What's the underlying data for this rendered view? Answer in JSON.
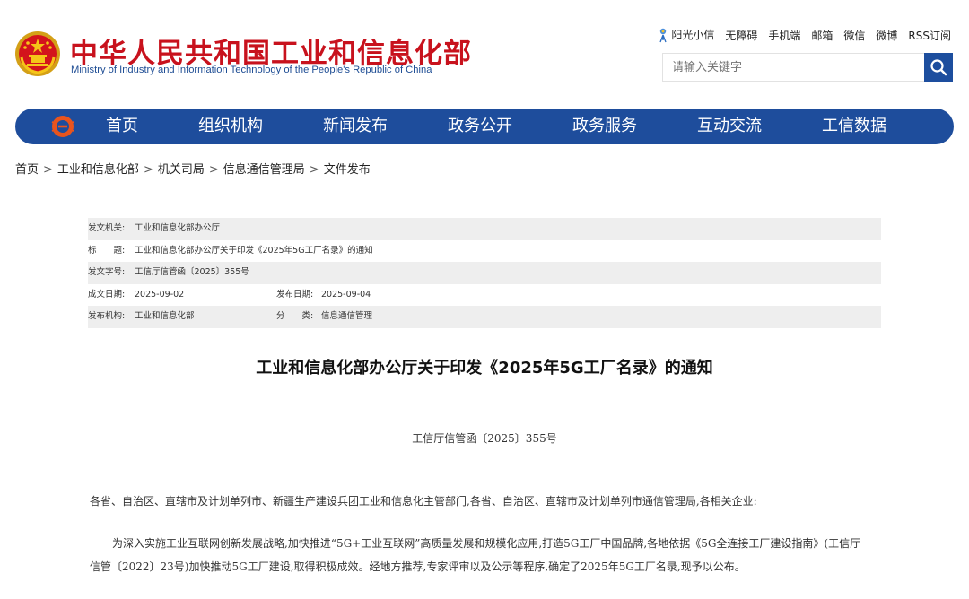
{
  "header": {
    "site_title": "中华人民共和国工业和信息化部",
    "site_subtitle": "Ministry of Industry and Information Technology of the People's Republic of China",
    "toplinks": [
      "阳光小信",
      "无障碍",
      "手机端",
      "邮箱",
      "微信",
      "微博",
      "RSS订阅"
    ],
    "search_placeholder": "请输入关键字",
    "colors": {
      "title_red": "#c8121d",
      "brand_blue": "#1e4d9c"
    },
    "icons": {
      "emblem": "national-emblem-icon",
      "search": "search-icon",
      "sun": "sunshine-icon"
    }
  },
  "nav": {
    "items": [
      "首页",
      "组织机构",
      "新闻发布",
      "政务公开",
      "政务服务",
      "互动交流",
      "工信数据"
    ]
  },
  "breadcrumb": [
    "首页",
    "工业和信息化部",
    "机关司局",
    "信息通信管理局",
    "文件发布"
  ],
  "meta": {
    "issuer_label": "发文机关:",
    "issuer": "工业和信息化部办公厅",
    "title_label": "标　　题:",
    "title": "工业和信息化部办公厅关于印发《2025年5G工厂名录》的通知",
    "docno_label": "发文字号:",
    "docno": "工信厅信管函〔2025〕355号",
    "created_label": "成文日期:",
    "created": "2025-09-02",
    "published_label": "发布日期:",
    "published": "2025-09-04",
    "org_label": "发布机构:",
    "org": "工业和信息化部",
    "category_label": "分　　类:",
    "category": "信息通信管理"
  },
  "article": {
    "title": "工业和信息化部办公厅关于印发《2025年5G工厂名录》的通知",
    "doc_number": "工信厅信管函〔2025〕355号",
    "recipients": "各省、自治区、直辖市及计划单列市、新疆生产建设兵团工业和信息化主管部门,各省、自治区、直辖市及计划单列市通信管理局,各相关企业:",
    "body": "为深入实施工业互联网创新发展战略,加快推进“5G+工业互联网”高质量发展和规模化应用,打造5G工厂中国品牌,各地依据《5G全连接工厂建设指南》(工信厅信管〔2022〕23号)加快推动5G工厂建设,取得积极成效。经地方推荐,专家评审以及公示等程序,确定了2025年5G工厂名录,现予以公布。"
  }
}
